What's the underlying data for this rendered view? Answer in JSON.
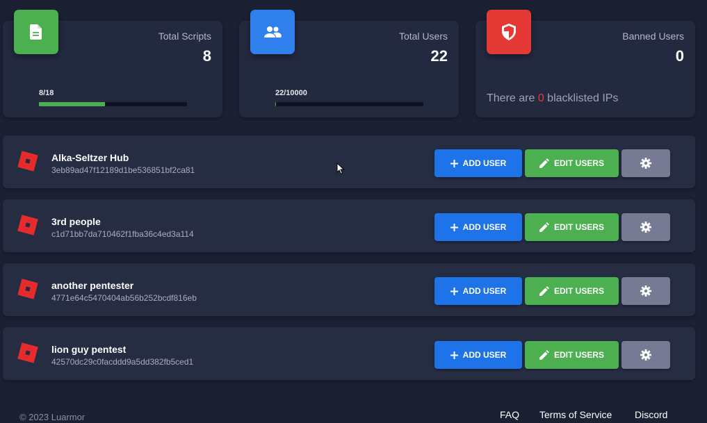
{
  "stats": {
    "scripts": {
      "title": "Total Scripts",
      "value": "8",
      "progress_label": "8/18",
      "progress_fraction": 0.444,
      "icon": "document-icon",
      "color": "#4caf50"
    },
    "users": {
      "title": "Total Users",
      "value": "22",
      "progress_label": "22/10000",
      "progress_fraction": 0.0022,
      "icon": "users-icon",
      "color": "#2f80ed"
    },
    "banned": {
      "title": "Banned Users",
      "value": "0",
      "text_before": "There are ",
      "count": "0",
      "text_after": " blacklisted IPs",
      "icon": "shield-icon",
      "color": "#e53935"
    }
  },
  "scripts": [
    {
      "name": "Alka-Seltzer Hub",
      "id": "3eb89ad47f12189d1be536851bf2ca81"
    },
    {
      "name": "3rd people",
      "id": "c1d71bb7da710462f1fba36c4ed3a114"
    },
    {
      "name": "another pentester",
      "id": "4771e64c5470404ab56b252bcdf816eb"
    },
    {
      "name": "lion guy pentest",
      "id": "42570dc29c0facddd9a5dd382fb5ced1"
    }
  ],
  "buttons": {
    "add_user": "ADD USER",
    "edit_users": "EDIT USERS",
    "add_icon": "plus-icon",
    "edit_icon": "pencil-icon",
    "settings_icon": "gear-icon"
  },
  "footer": {
    "copyright": "© 2023 Luarmor",
    "links": [
      "FAQ",
      "Terms of Service",
      "Discord"
    ]
  },
  "colors": {
    "background": "#1b2033",
    "card": "#232a3f",
    "add_button": "#1e73e8",
    "edit_button": "#4caf50",
    "settings_button": "#767b93",
    "roblox_logo": "#e52b2b"
  }
}
